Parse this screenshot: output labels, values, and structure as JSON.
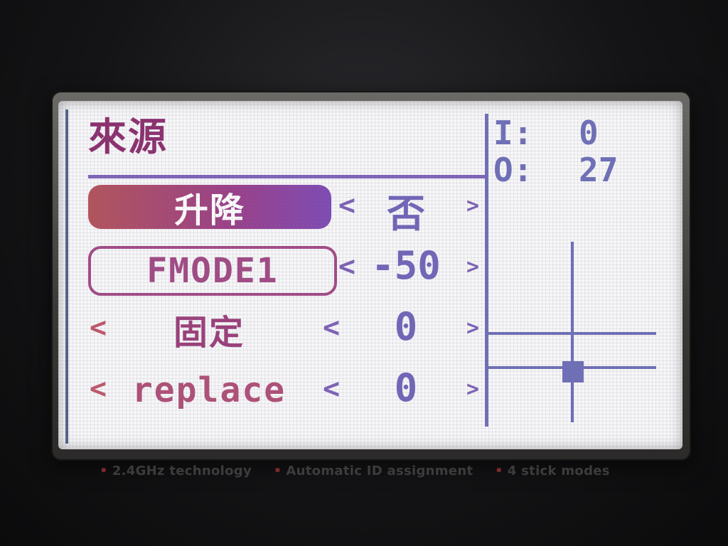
{
  "screen": {
    "title": "來源",
    "io": {
      "in_label": "I:",
      "in_value": "0",
      "out_label": "O:",
      "out_value": "27"
    },
    "rows": [
      {
        "label": "升降",
        "value": "否",
        "left_arrow": "<",
        "right_arrow": ">"
      },
      {
        "label": "FMODE1",
        "value": "-50",
        "left_arrow": "<",
        "right_arrow": ">"
      },
      {
        "label": "固定",
        "value": "0",
        "left_arrow": "<",
        "right_arrow": ">",
        "mid_open": "<"
      },
      {
        "label": "replace",
        "value": "0",
        "left_arrow": "<",
        "right_arrow": ">",
        "mid_open": "<"
      }
    ],
    "colors": {
      "accent_purple": "#7065b8",
      "accent_magenta": "#9b3f8a",
      "accent_red": "#b4535a",
      "lcd_bg": "#f6f6f8"
    }
  },
  "bezel": {
    "features": [
      "2.4GHz technology",
      "Automatic ID assignment",
      "4 stick modes"
    ]
  }
}
